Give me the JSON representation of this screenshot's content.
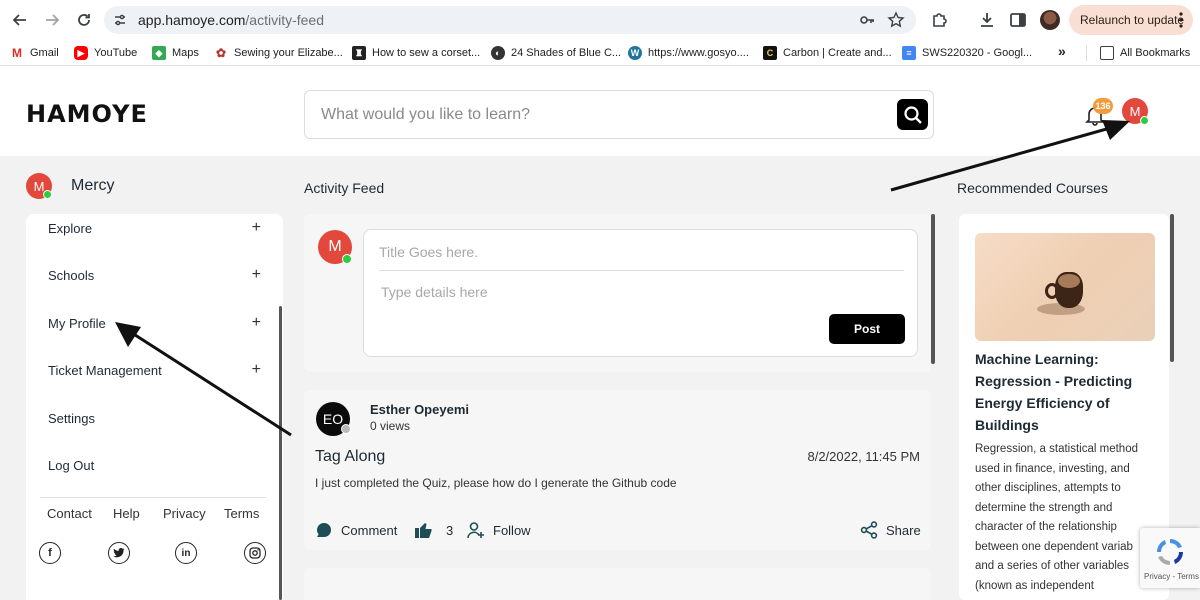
{
  "browser": {
    "url_domain": "app.hamoye.com",
    "url_path": "/activity-feed",
    "relaunch_label": "Relaunch to update",
    "bookmarks": [
      {
        "label": "Gmail",
        "icon": "gmail-icon",
        "color": "#d93025"
      },
      {
        "label": "YouTube",
        "icon": "youtube-icon",
        "color": "#ff0000"
      },
      {
        "label": "Maps",
        "icon": "maps-icon",
        "color": "#34a853"
      },
      {
        "label": "Sewing your Elizabe...",
        "icon": "sewing-icon",
        "color": "#b03a2e"
      },
      {
        "label": "How to sew a corset...",
        "icon": "corset-icon",
        "color": "#222222"
      },
      {
        "label": "24 Shades of Blue C...",
        "icon": "globe-icon",
        "color": "#333333"
      },
      {
        "label": "https://www.gosyo....",
        "icon": "wordpress-icon",
        "color": "#21759b"
      },
      {
        "label": "Carbon | Create and...",
        "icon": "carbon-icon",
        "color": "#111111"
      },
      {
        "label": "SWS220320 - Googl...",
        "icon": "docs-icon",
        "color": "#4285f4"
      }
    ],
    "bookmarks_more": "»",
    "all_bookmarks_label": "All Bookmarks"
  },
  "header": {
    "logo_text": "HAMOYE",
    "search_placeholder": "What would you like to learn?",
    "notification_count": "136",
    "avatar_initial": "M"
  },
  "sidebar": {
    "user_name": "Mercy",
    "avatar_initial": "M",
    "items": [
      {
        "label": "Explore",
        "expandable": "+"
      },
      {
        "label": "Schools",
        "expandable": "+"
      },
      {
        "label": "My Profile",
        "expandable": "+"
      },
      {
        "label": "Ticket Management",
        "expandable": "+"
      },
      {
        "label": "Settings",
        "expandable": ""
      },
      {
        "label": "Log Out",
        "expandable": ""
      }
    ],
    "footer_links": [
      "Contact",
      "Help",
      "Privacy",
      "Terms"
    ],
    "social": [
      "facebook-icon",
      "twitter-icon",
      "linkedin-icon",
      "instagram-icon"
    ]
  },
  "feed": {
    "title": "Activity Feed",
    "compose": {
      "avatar_initial": "M",
      "title_placeholder": "Title Goes here.",
      "details_placeholder": "Type details here",
      "post_label": "Post"
    },
    "post": {
      "author_initials": "EO",
      "author": "Esther Opeyemi",
      "views": "0 views",
      "title": "Tag Along",
      "date": "8/2/2022, 11:45 PM",
      "body": "I just completed the Quiz, please how do I generate the Github code",
      "comment_label": "Comment",
      "like_count": "3",
      "follow_label": "Follow",
      "share_label": "Share"
    }
  },
  "recommended": {
    "title": "Recommended Courses",
    "course_title": "Machine Learning: Regression - Predicting Energy Efficiency of Buildings",
    "course_desc": "Regression, a statistical method used in finance, investing, and other disciplines, attempts to determine the strength and character of the relationship between one dependent variab and a series of other variables (known as independent"
  },
  "recaptcha": {
    "text": "Privacy - Terms"
  },
  "colors": {
    "avatar_red": "#e2483b",
    "online_green": "#2ecc40",
    "badge_orange": "#f39c3d",
    "relaunch_bg": "#f9dfd3",
    "icon_teal": "#1d4e57"
  }
}
